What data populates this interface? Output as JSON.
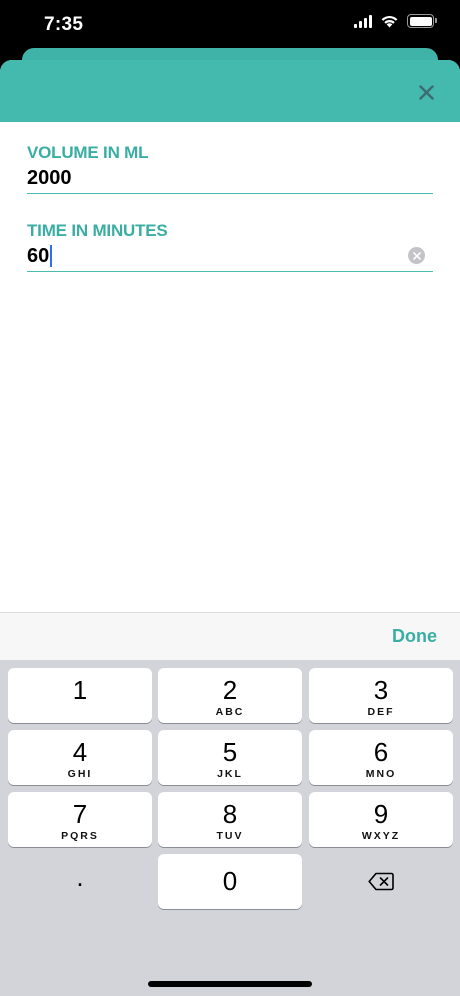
{
  "status": {
    "time": "7:35"
  },
  "form": {
    "volume": {
      "label": "VOLUME IN ML",
      "value": "2000"
    },
    "time": {
      "label": "TIME IN MINUTES",
      "value": "60"
    }
  },
  "accessory": {
    "done_label": "Done"
  },
  "keypad": {
    "keys": [
      {
        "num": "1",
        "letters": ""
      },
      {
        "num": "2",
        "letters": "ABC"
      },
      {
        "num": "3",
        "letters": "DEF"
      },
      {
        "num": "4",
        "letters": "GHI"
      },
      {
        "num": "5",
        "letters": "JKL"
      },
      {
        "num": "6",
        "letters": "MNO"
      },
      {
        "num": "7",
        "letters": "PQRS"
      },
      {
        "num": "8",
        "letters": "TUV"
      },
      {
        "num": "9",
        "letters": "WXYZ"
      },
      {
        "num": ".",
        "letters": ""
      },
      {
        "num": "0",
        "letters": ""
      }
    ]
  },
  "colors": {
    "accent": "#44b9ad",
    "label": "#3aaea3",
    "keyboard_bg": "#d2d4da"
  },
  "icons": {
    "close": "close-icon",
    "clear": "clear-icon",
    "delete": "backspace-icon",
    "wifi": "wifi-icon",
    "battery": "battery-icon",
    "signal": "signal-icon"
  }
}
